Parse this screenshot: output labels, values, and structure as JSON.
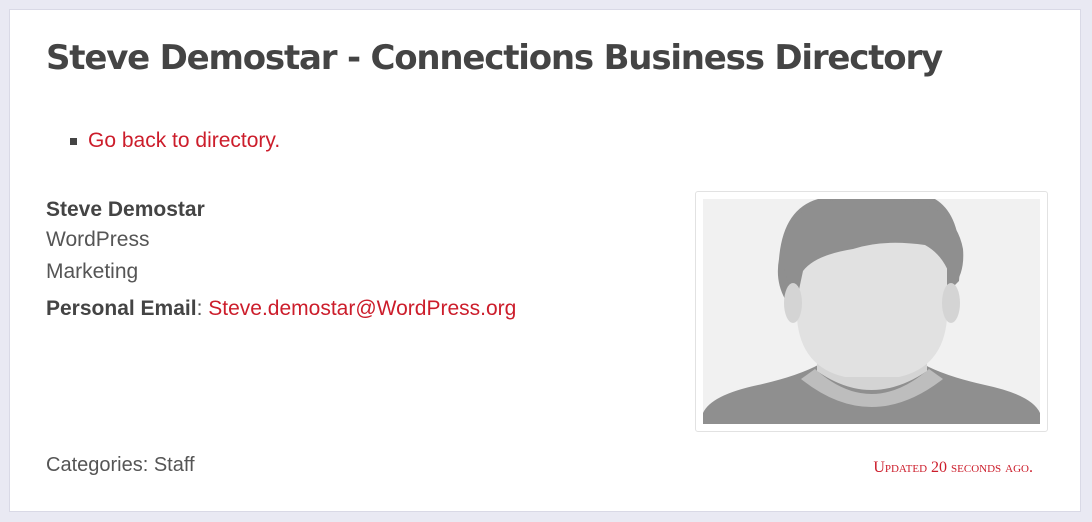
{
  "page": {
    "title": "Steve Demostar - Connections Business Directory"
  },
  "nav": {
    "back_link": "Go back to directory."
  },
  "contact": {
    "name": "Steve Demostar",
    "organization": "WordPress",
    "department": "Marketing",
    "email_label": "Personal Email",
    "email_separator": ":",
    "email_value": "Steve.demostar@WordPress.org"
  },
  "photo": {
    "icon": "placeholder-person-silhouette"
  },
  "footer": {
    "categories": "Categories: Staff",
    "updated": "Updated 20 seconds ago."
  },
  "colors": {
    "link": "#cc1d2b",
    "text": "#444444",
    "background": "#e9e9f3"
  }
}
